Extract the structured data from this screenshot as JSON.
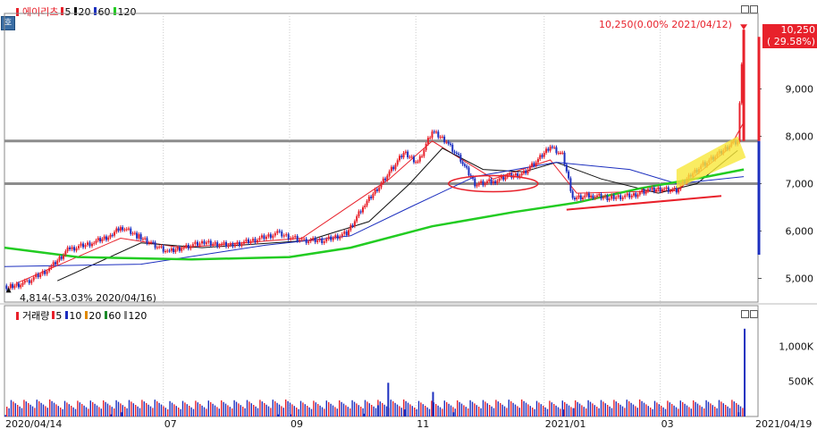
{
  "legend": {
    "title": "에이리츠",
    "ma": [
      {
        "label": "5",
        "color": "#e8212b"
      },
      {
        "label": "20",
        "color": "#111111"
      },
      {
        "label": "60",
        "color": "#1c2fbf"
      },
      {
        "label": "120",
        "color": "#22cc22"
      }
    ],
    "title_color": "#e8212b",
    "toggle_label": "호"
  },
  "volume_legend": {
    "title": "거래량",
    "ma": [
      {
        "label": "5",
        "color": "#e8212b"
      },
      {
        "label": "10",
        "color": "#1c2fbf"
      },
      {
        "label": "20",
        "color": "#e08a00"
      },
      {
        "label": "60",
        "color": "#1b8a2a"
      },
      {
        "label": "120",
        "color": "#888888"
      }
    ]
  },
  "annotations": {
    "high": "10,250(0.00% 2021/04/12)",
    "low": "4,814(-53.03% 2020/04/16)"
  },
  "price_badge": {
    "price": "10,250",
    "change": "( 29.58%)",
    "color": "#e8212b"
  },
  "chart_data": [
    {
      "type": "candlestick",
      "title": "에이리츠",
      "ylim": [
        4500,
        10500
      ],
      "y_ticks": [
        "5,000",
        "6,000",
        "7,000",
        "8,000",
        "9,000"
      ],
      "y_tick_values": [
        5000,
        6000,
        7000,
        8000,
        9000
      ],
      "x_ticks": [
        "2020/04/14",
        "07",
        "09",
        "11",
        "2021/01",
        "03",
        "2021/04/19"
      ],
      "horizontal_lines": [
        7900,
        7000
      ],
      "close_points": [
        [
          "2020-04-14",
          4850
        ],
        [
          "2020-04-16",
          4814
        ],
        [
          "2020-04-24",
          4900
        ],
        [
          "2020-05-06",
          5200
        ],
        [
          "2020-05-15",
          5600
        ],
        [
          "2020-05-27",
          5750
        ],
        [
          "2020-06-05",
          5900
        ],
        [
          "2020-06-10",
          6100
        ],
        [
          "2020-06-18",
          5900
        ],
        [
          "2020-06-25",
          5750
        ],
        [
          "2020-07-03",
          5550
        ],
        [
          "2020-07-10",
          5650
        ],
        [
          "2020-07-20",
          5750
        ],
        [
          "2020-08-03",
          5700
        ],
        [
          "2020-08-14",
          5800
        ],
        [
          "2020-08-26",
          5950
        ],
        [
          "2020-09-07",
          5800
        ],
        [
          "2020-09-18",
          5800
        ],
        [
          "2020-09-29",
          5950
        ],
        [
          "2020-10-07",
          6500
        ],
        [
          "2020-10-14",
          6900
        ],
        [
          "2020-10-21",
          7300
        ],
        [
          "2020-10-27",
          7650
        ],
        [
          "2020-11-03",
          7450
        ],
        [
          "2020-11-10",
          8100
        ],
        [
          "2020-11-17",
          7900
        ],
        [
          "2020-11-24",
          7500
        ],
        [
          "2020-12-01",
          7000
        ],
        [
          "2020-12-10",
          7050
        ],
        [
          "2020-12-17",
          7150
        ],
        [
          "2020-12-24",
          7200
        ],
        [
          "2020-12-31",
          7450
        ],
        [
          "2021-01-07",
          7800
        ],
        [
          "2021-01-13",
          7600
        ],
        [
          "2021-01-18",
          6700
        ],
        [
          "2021-01-27",
          6750
        ],
        [
          "2021-02-05",
          6700
        ],
        [
          "2021-02-16",
          6750
        ],
        [
          "2021-02-24",
          6850
        ],
        [
          "2021-03-03",
          6900
        ],
        [
          "2021-03-10",
          6850
        ],
        [
          "2021-03-16",
          7150
        ],
        [
          "2021-03-23",
          7400
        ],
        [
          "2021-03-30",
          7600
        ],
        [
          "2021-04-06",
          7850
        ],
        [
          "2021-04-09",
          7900
        ],
        [
          "2021-04-12",
          10250
        ]
      ],
      "ma_series": [
        {
          "name": "5",
          "color": "#e8212b",
          "points": [
            [
              "2020-04-20",
              4900
            ],
            [
              "2020-06-10",
              5850
            ],
            [
              "2020-07-10",
              5650
            ],
            [
              "2020-09-07",
              5850
            ],
            [
              "2020-10-20",
              7100
            ],
            [
              "2020-11-10",
              7900
            ],
            [
              "2020-12-10",
              7100
            ],
            [
              "2021-01-07",
              7500
            ],
            [
              "2021-01-20",
              6800
            ],
            [
              "2021-03-10",
              6850
            ],
            [
              "2021-04-05",
              7750
            ],
            [
              "2021-04-12",
              8300
            ]
          ]
        },
        {
          "name": "20",
          "color": "#111111",
          "points": [
            [
              "2020-05-10",
              4950
            ],
            [
              "2020-06-20",
              5750
            ],
            [
              "2020-07-20",
              5650
            ],
            [
              "2020-09-10",
              5800
            ],
            [
              "2020-10-10",
              6200
            ],
            [
              "2020-10-30",
              7000
            ],
            [
              "2020-11-15",
              7750
            ],
            [
              "2020-12-05",
              7300
            ],
            [
              "2020-12-25",
              7250
            ],
            [
              "2021-01-10",
              7450
            ],
            [
              "2021-02-01",
              7100
            ],
            [
              "2021-03-01",
              6800
            ],
            [
              "2021-03-20",
              7000
            ],
            [
              "2021-04-09",
              7700
            ]
          ]
        },
        {
          "name": "60",
          "color": "#1c2fbf",
          "points": [
            [
              "2020-04-14",
              5250
            ],
            [
              "2020-06-20",
              5300
            ],
            [
              "2020-08-20",
              5700
            ],
            [
              "2020-10-01",
              5900
            ],
            [
              "2020-10-30",
              6500
            ],
            [
              "2020-12-01",
              7150
            ],
            [
              "2021-01-10",
              7450
            ],
            [
              "2021-02-15",
              7300
            ],
            [
              "2021-03-10",
              7000
            ],
            [
              "2021-04-12",
              7150
            ]
          ]
        },
        {
          "name": "120",
          "color": "#22cc22",
          "points": [
            [
              "2020-04-14",
              5650
            ],
            [
              "2020-05-20",
              5450
            ],
            [
              "2020-07-15",
              5400
            ],
            [
              "2020-09-01",
              5450
            ],
            [
              "2020-10-01",
              5650
            ],
            [
              "2020-11-10",
              6100
            ],
            [
              "2020-12-20",
              6400
            ],
            [
              "2021-01-20",
              6600
            ],
            [
              "2021-02-20",
              6900
            ],
            [
              "2021-03-25",
              7150
            ],
            [
              "2021-04-12",
              7300
            ]
          ]
        }
      ]
    },
    {
      "type": "bar",
      "title": "거래량",
      "ylim": [
        0,
        1400000
      ],
      "y_ticks": [
        "500K",
        "1,000K"
      ],
      "y_tick_values": [
        500000,
        1000000
      ],
      "spikes": [
        [
          "2020-04-14",
          20000
        ],
        [
          "2020-06-05",
          30000
        ],
        [
          "2020-06-10",
          60000
        ],
        [
          "2020-08-26",
          30000
        ],
        [
          "2020-09-01",
          30000
        ],
        [
          "2020-10-07",
          40000
        ],
        [
          "2020-10-14",
          160000
        ],
        [
          "2020-10-19",
          480000
        ],
        [
          "2020-10-27",
          100000
        ],
        [
          "2020-11-10",
          350000
        ],
        [
          "2020-11-20",
          60000
        ],
        [
          "2021-01-13",
          100000
        ],
        [
          "2021-01-18",
          120000
        ],
        [
          "2021-04-09",
          60000
        ],
        [
          "2021-04-12",
          1250000
        ]
      ]
    }
  ]
}
